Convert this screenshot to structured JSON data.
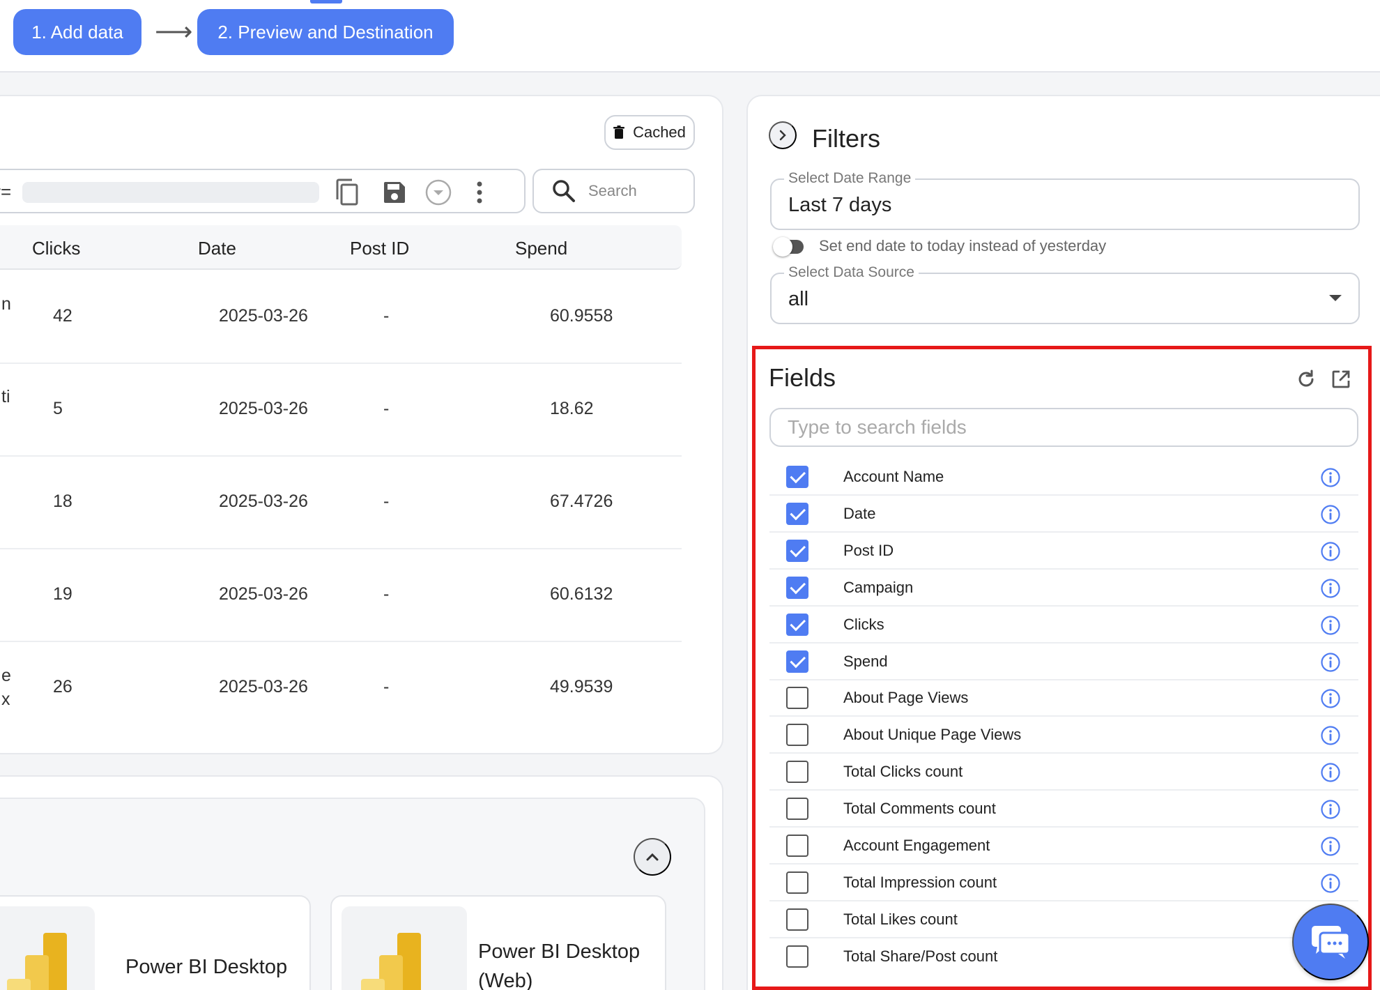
{
  "stepper": {
    "step1_label": "1. Add data",
    "arrow": "⟶",
    "step2_label": "2. Preview and Destination"
  },
  "preview": {
    "cached_label": "Cached",
    "url_prefix": "y=",
    "search_placeholder": "Search",
    "columns": [
      "Clicks",
      "Date",
      "Post ID",
      "Spend"
    ],
    "rows": [
      {
        "partial": "n",
        "clicks": "42",
        "date": "2025-03-26",
        "post_id": "-",
        "spend": "60.9558"
      },
      {
        "partial": "ti",
        "clicks": "5",
        "date": "2025-03-26",
        "post_id": "-",
        "spend": "18.62"
      },
      {
        "partial": "",
        "clicks": "18",
        "date": "2025-03-26",
        "post_id": "-",
        "spend": "67.4726"
      },
      {
        "partial": "",
        "clicks": "19",
        "date": "2025-03-26",
        "post_id": "-",
        "spend": "60.6132"
      },
      {
        "partial": "e\nx",
        "clicks": "26",
        "date": "2025-03-26",
        "post_id": "-",
        "spend": "49.9539"
      }
    ]
  },
  "destinations": {
    "tiles": [
      {
        "label": "Power BI Desktop"
      },
      {
        "label": "Power BI Desktop\n(Web)"
      }
    ]
  },
  "filters": {
    "title": "Filters",
    "date_range_label": "Select Date Range",
    "date_range_value": "Last 7 days",
    "toggle_label": "Set end date to today instead of yesterday",
    "data_source_label": "Select Data Source",
    "data_source_value": "all"
  },
  "fields": {
    "title": "Fields",
    "search_placeholder": "Type to search fields",
    "items": [
      {
        "name": "Account Name",
        "checked": true
      },
      {
        "name": "Date",
        "checked": true
      },
      {
        "name": "Post ID",
        "checked": true
      },
      {
        "name": "Campaign",
        "checked": true
      },
      {
        "name": "Clicks",
        "checked": true
      },
      {
        "name": "Spend",
        "checked": true
      },
      {
        "name": "About Page Views",
        "checked": false
      },
      {
        "name": "About Unique Page Views",
        "checked": false
      },
      {
        "name": "Total Clicks count",
        "checked": false
      },
      {
        "name": "Total Comments count",
        "checked": false
      },
      {
        "name": "Account Engagement",
        "checked": false
      },
      {
        "name": "Total Impression count",
        "checked": false
      },
      {
        "name": "Total Likes count",
        "checked": false
      },
      {
        "name": "Total Share/Post count",
        "checked": false
      }
    ]
  },
  "colors": {
    "accent": "#4f7cf2",
    "highlight": "#e61919"
  },
  "icons": {
    "cached": "trash-icon",
    "copy": "copy-icon",
    "save": "save-icon",
    "dropdown": "chevron-down-circle-icon",
    "more": "more-vertical-icon",
    "search": "search-icon",
    "filters_toggle": "chevron-right-icon",
    "refresh": "refresh-icon",
    "open_external": "external-link-icon",
    "info": "info-icon",
    "collapse": "chevron-up-icon",
    "chat": "chat-icon"
  }
}
